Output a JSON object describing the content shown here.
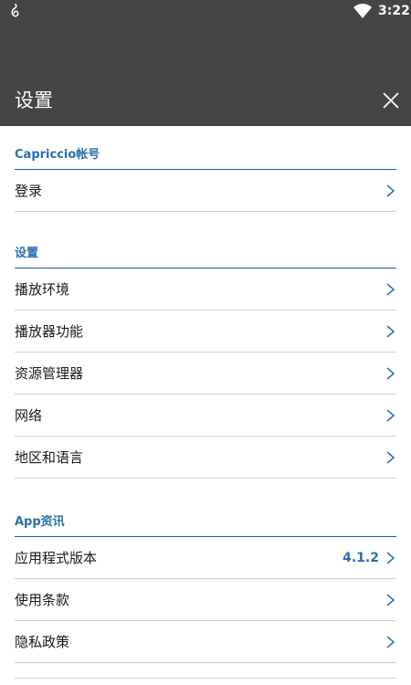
{
  "statusbar": {
    "time": "3:22",
    "app_icon": "music-note-icon",
    "wifi_icon": "wifi-icon"
  },
  "header": {
    "title": "设置",
    "close_icon": "close-icon"
  },
  "sections": [
    {
      "title": "Capriccio帐号",
      "items": [
        {
          "label": "登录"
        }
      ]
    },
    {
      "title": "设置",
      "items": [
        {
          "label": "播放环境"
        },
        {
          "label": "播放器功能"
        },
        {
          "label": "资源管理器"
        },
        {
          "label": "网络"
        },
        {
          "label": "地区和语言"
        }
      ]
    },
    {
      "title": "App资讯",
      "items": [
        {
          "label": "应用程式版本",
          "value": "4.1.2"
        },
        {
          "label": "使用条款"
        },
        {
          "label": "隐私政策"
        }
      ]
    }
  ],
  "colors": {
    "appbar": "#454545",
    "accent": "#2a6fad",
    "divider": "#d2d2d2"
  }
}
